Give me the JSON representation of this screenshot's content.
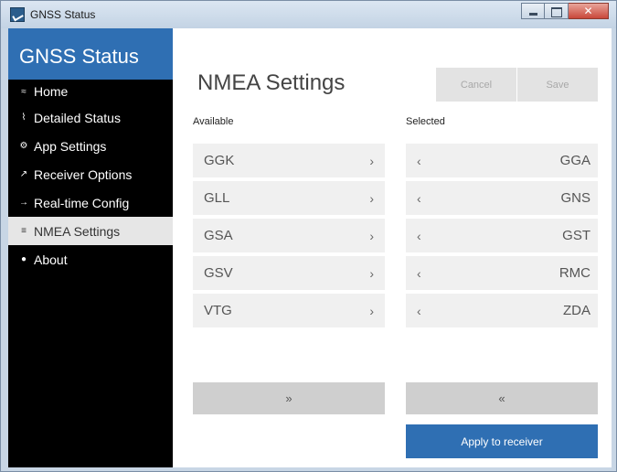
{
  "window": {
    "title": "GNSS Status"
  },
  "sidebar": {
    "header": "GNSS Status",
    "items": [
      {
        "label": "Home",
        "icon": "≈"
      },
      {
        "label": "Detailed Status",
        "icon": "⌇"
      },
      {
        "label": "App Settings",
        "icon": "⚙"
      },
      {
        "label": "Receiver Options",
        "icon": "↗"
      },
      {
        "label": "Real-time Config",
        "icon": "→"
      },
      {
        "label": "NMEA Settings",
        "icon": "≡"
      },
      {
        "label": "About",
        "icon": "●"
      }
    ]
  },
  "main": {
    "title": "NMEA Settings",
    "cancel_label": "Cancel",
    "save_label": "Save",
    "available_label": "Available",
    "selected_label": "Selected",
    "available": [
      "GGK",
      "GLL",
      "GSA",
      "GSV",
      "VTG"
    ],
    "selected": [
      "GGA",
      "GNS",
      "GST",
      "RMC",
      "ZDA"
    ],
    "chevron_right": "›",
    "chevron_left": "‹",
    "move_all_right": "»",
    "move_all_left": "«",
    "apply_label": "Apply to receiver"
  },
  "colors": {
    "accent": "#2f6fb3",
    "sidebar_bg": "#000000",
    "active_item_bg": "#e6e6e6"
  }
}
